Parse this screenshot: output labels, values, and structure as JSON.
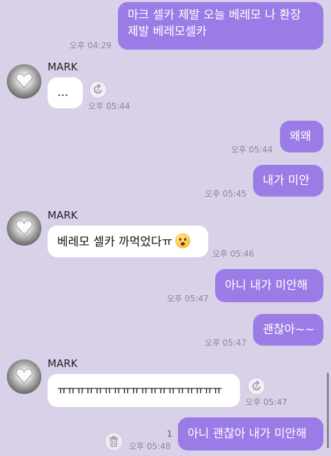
{
  "messages": [
    {
      "side": "out",
      "text_lines": [
        "마크 셀카 제발 오늘 베레모 나 환장",
        "제발 베레모셀카"
      ],
      "time": "오후 04:29"
    },
    {
      "side": "in",
      "sender": "MARK",
      "text": "...",
      "time": "오후 05:44"
    },
    {
      "side": "out",
      "text": "왜왜",
      "time": "오후 05:44"
    },
    {
      "side": "out",
      "text": "내가 미안",
      "time": "오후 05:45"
    },
    {
      "side": "in",
      "sender": "MARK",
      "text": "베레모 셀카 까먹었다ㅠ",
      "emoji": "worried-face-icon",
      "time": "오후 05:46"
    },
    {
      "side": "out",
      "text": "아니 내가 미안해",
      "time": "오후 05:47"
    },
    {
      "side": "out",
      "text": "괜찮아~~",
      "time": "오후 05:47"
    },
    {
      "side": "in",
      "sender": "MARK",
      "text": "ㅠㅠㅠㅠㅠㅠㅠㅠㅠㅠㅠㅠㅠㅠㅠㅠㅠㅠ",
      "time": "오후 05:47"
    },
    {
      "side": "out",
      "text": "아니 괜찮아 내가 미안해",
      "time": "오후 05:48",
      "unread": "1"
    }
  ],
  "colors": {
    "background": "#d9d1e8",
    "outgoing_bubble": "#9b7ce6",
    "incoming_bubble": "#ffffff",
    "time_text": "#8d8799"
  },
  "icons": {
    "avatar": "heart-hand-avatar",
    "reply": "reply-arrow-icon",
    "delete": "trash-icon"
  }
}
